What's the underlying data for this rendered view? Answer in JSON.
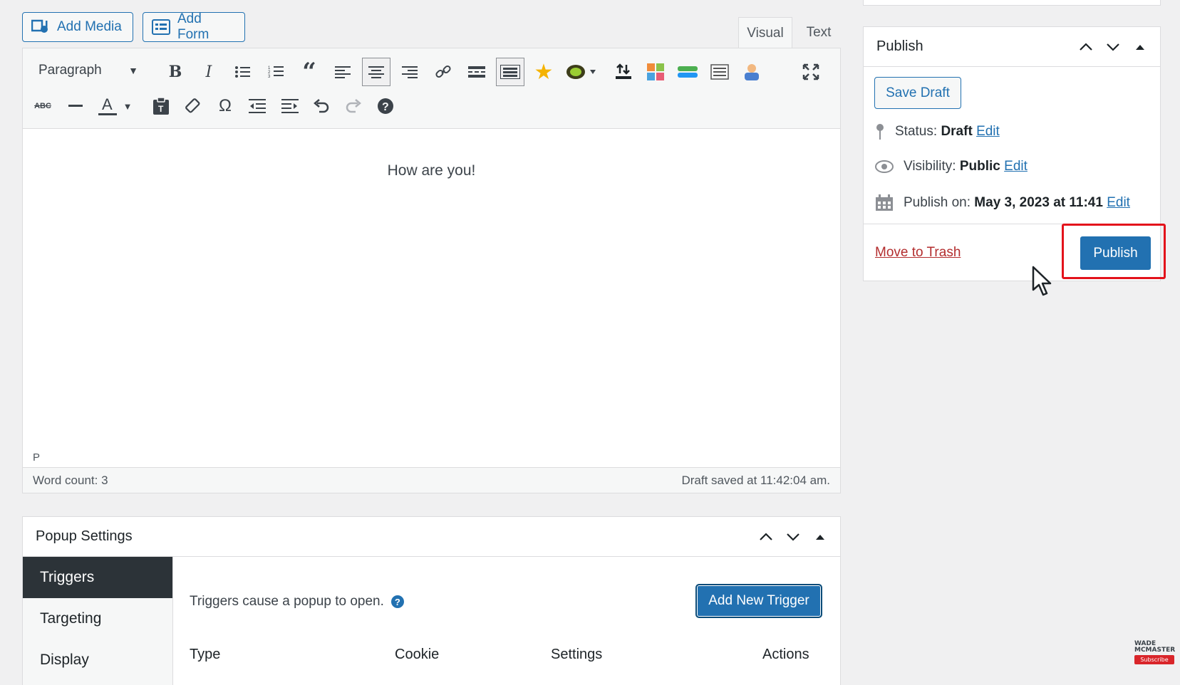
{
  "media_buttons": {
    "add_media": "Add Media",
    "add_form": "Add Form"
  },
  "editor_tabs": {
    "visual": "Visual",
    "text": "Text"
  },
  "toolbar": {
    "format_select": "Paragraph"
  },
  "editor": {
    "content": "How are you!",
    "path": "P",
    "word_count": "Word count: 3",
    "draft_saved": "Draft saved at 11:42:04 am."
  },
  "publish": {
    "title": "Publish",
    "save_draft": "Save Draft",
    "status_label": "Status:",
    "status_value": "Draft",
    "visibility_label": "Visibility:",
    "visibility_value": "Public",
    "publish_on_label": "Publish on:",
    "publish_on_value": "May 3, 2023 at 11:41",
    "edit": "Edit",
    "move_to_trash": "Move to Trash",
    "publish_button": "Publish"
  },
  "popup": {
    "title": "Popup Settings",
    "tabs": [
      "Triggers",
      "Targeting",
      "Display"
    ],
    "description": "Triggers cause a popup to open.",
    "help": "?",
    "add_trigger": "Add New Trigger",
    "columns": [
      "Type",
      "Cookie",
      "Settings",
      "Actions"
    ]
  },
  "watermark": {
    "text": "WADE MCMASTER",
    "subscribe": "Subscribe"
  },
  "colors": {
    "accent": "#2271b1",
    "highlight": "#e3121b",
    "trash": "#b32d2e"
  }
}
